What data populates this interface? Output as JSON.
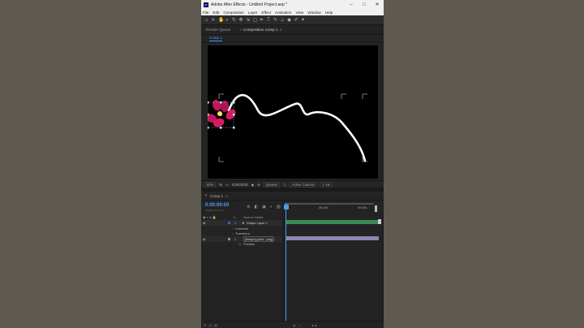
{
  "window": {
    "title": "Adobe After Effects - Untitled Project.aep *",
    "logo_text": "Ae",
    "minimize_glyph": "–",
    "maximize_glyph": "□",
    "close_glyph": "✕"
  },
  "menu": [
    "File",
    "Edit",
    "Composition",
    "Layer",
    "Effect",
    "Animation",
    "View",
    "Window",
    "Help"
  ],
  "toolbar": {
    "tools": [
      "home-icon",
      "selection-tool-icon",
      "hand-tool-icon",
      "zoom-tool-icon",
      "orbit-camera-icon",
      "pan-camera-icon",
      "dolly-camera-icon",
      "rectangle-tool-icon",
      "pen-tool-icon",
      "type-tool-icon",
      "brush-tool-icon",
      "clone-stamp-icon",
      "eraser-icon",
      "roto-brush-icon",
      "puppet-pin-icon"
    ],
    "active_color": "#4a9dff"
  },
  "tabs": {
    "render_queue": "Render Queue",
    "composition": "Composition Comp 1",
    "sub_tab": "Comp 1"
  },
  "viewer_controls": {
    "zoom": "50%",
    "timecode": "0;00;00;00",
    "resolution": "Quarter",
    "camera": "Active Camera",
    "views": "1 Vie"
  },
  "timeline": {
    "tab_label": "Comp 1",
    "timecode": "0:00:00:00",
    "fps_text": "00000 (29.97 fps)",
    "ruler_labels": [
      "0s",
      "00:15s",
      "00:30s"
    ],
    "column_header": "Source Name",
    "rows": [
      {
        "num": "1",
        "name": "Shape Layer 1",
        "icon": "star-icon"
      },
      {
        "name": "Contents"
      },
      {
        "name": "Transform"
      },
      {
        "num": "2",
        "name": "[kisspng-pink...png]"
      },
      {
        "name": "Position"
      }
    ]
  },
  "colors": {
    "accent": "#4a9dff",
    "shape_layer_bar": "#3b8a54",
    "image_layer_bar": "#8d85b4",
    "flower": "#c2185b"
  }
}
